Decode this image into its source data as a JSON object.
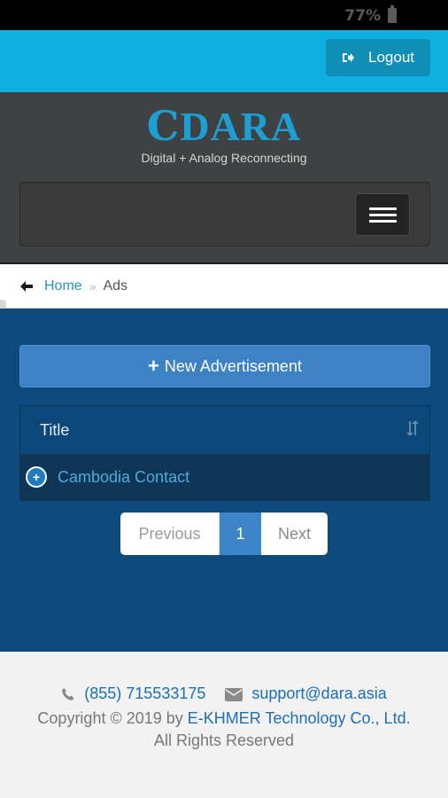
{
  "status_bar": {
    "battery": "77%"
  },
  "topbar": {
    "logout_label": "Logout",
    "accent_color": "#0fb1e1"
  },
  "header": {
    "logo_text": "DARA",
    "logo_mark": "Ⅽ",
    "tagline": "Digital + Analog Reconnecting"
  },
  "breadcrumb": {
    "home": "Home",
    "separator": "»",
    "current": "Ads"
  },
  "main": {
    "new_ad_plus": "+",
    "new_ad_label": "New Advertisement",
    "table": {
      "header": "Title",
      "rows": [
        {
          "expand": "+",
          "title": "Cambodia Contact"
        }
      ]
    },
    "pagination": {
      "previous": "Previous",
      "current": "1",
      "next": "Next"
    }
  },
  "footer": {
    "phone": "(855) 715533175",
    "email": "support@dara.asia",
    "copyright_prefix": "Copyright © 2019 by",
    "company": "E-KHMER Technology Co., Ltd.",
    "rights": "All Rights Reserved"
  }
}
